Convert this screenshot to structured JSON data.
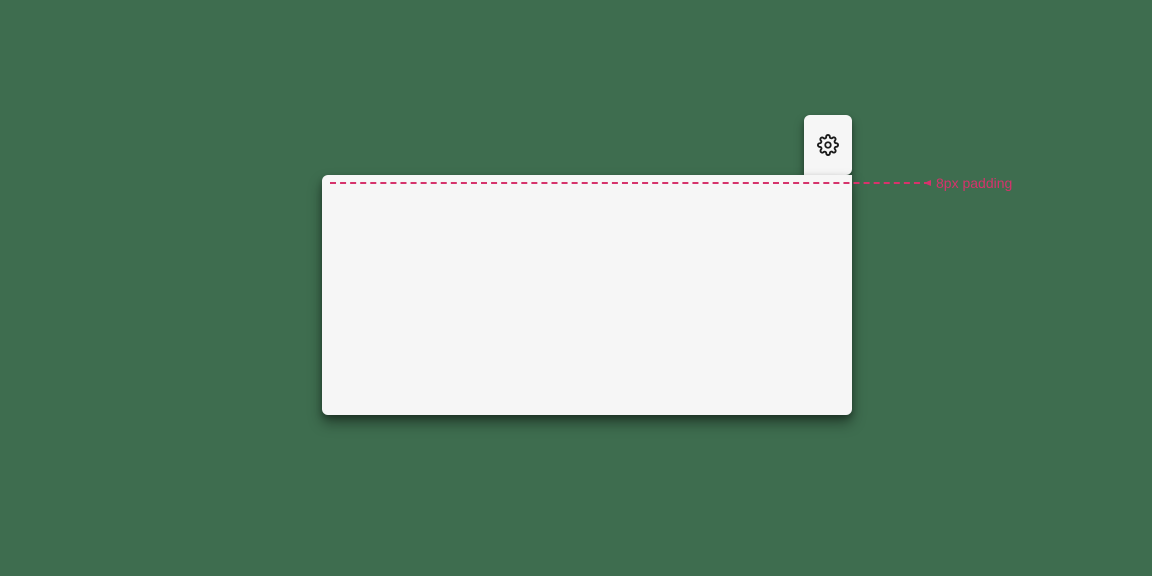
{
  "annotation": {
    "padding_label": "8px padding",
    "accent_color": "#d6336c"
  },
  "icons": {
    "settings": "gear-icon"
  },
  "colors": {
    "background": "#3e6d4f",
    "panel": "#f6f6f6",
    "accent": "#d6336c"
  }
}
